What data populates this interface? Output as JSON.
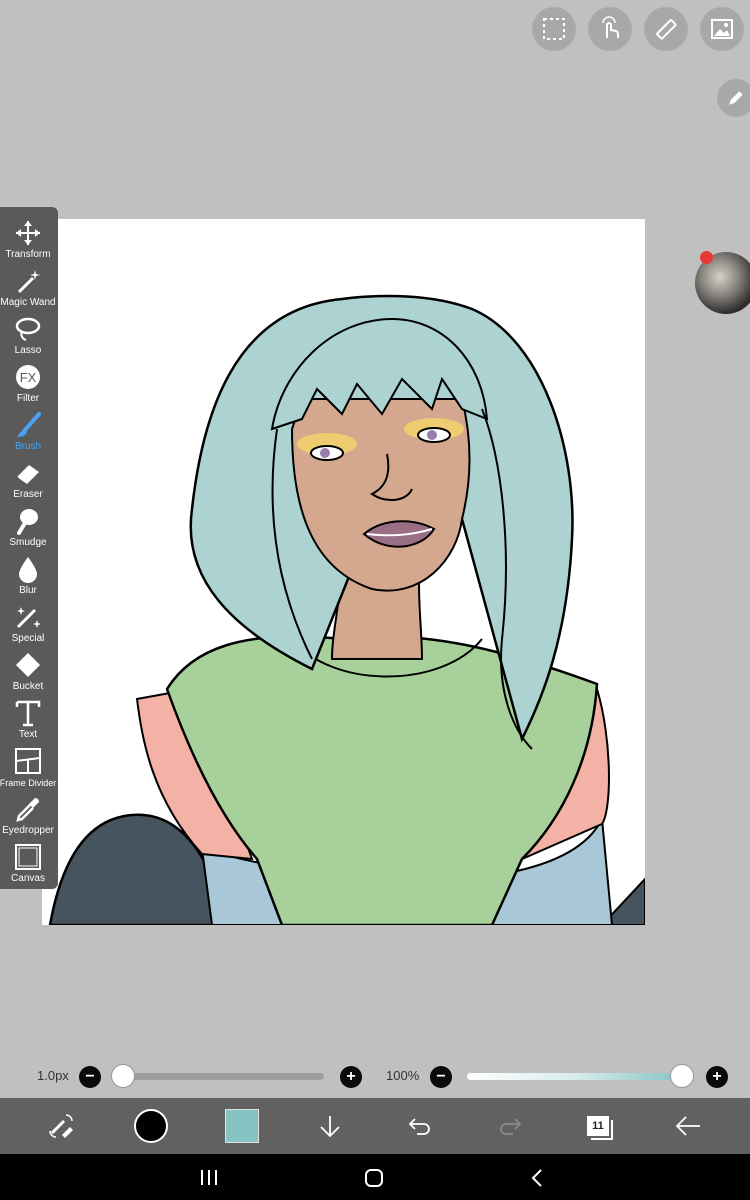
{
  "top_buttons": [
    {
      "name": "selection-icon"
    },
    {
      "name": "hand-touch-icon"
    },
    {
      "name": "ruler-icon"
    },
    {
      "name": "image-icon"
    }
  ],
  "side": {
    "pen_icon": "pencil-icon",
    "avatar": "user-avatar"
  },
  "toolbar": {
    "items": [
      {
        "label": "Transform",
        "icon": "move-arrows-icon"
      },
      {
        "label": "Magic Wand",
        "icon": "magic-wand-icon"
      },
      {
        "label": "Lasso",
        "icon": "lasso-icon"
      },
      {
        "label": "Filter",
        "icon": "fx-icon"
      },
      {
        "label": "Brush",
        "icon": "brush-icon",
        "active": true
      },
      {
        "label": "Eraser",
        "icon": "eraser-icon"
      },
      {
        "label": "Smudge",
        "icon": "smudge-icon"
      },
      {
        "label": "Blur",
        "icon": "droplet-icon"
      },
      {
        "label": "Special",
        "icon": "special-wand-icon"
      },
      {
        "label": "Bucket",
        "icon": "bucket-icon"
      },
      {
        "label": "Text",
        "icon": "text-icon"
      },
      {
        "label": "Frame Divider",
        "icon": "frame-divider-icon"
      },
      {
        "label": "Eyedropper",
        "icon": "eyedropper-icon"
      },
      {
        "label": "Canvas",
        "icon": "canvas-icon"
      }
    ],
    "accent": "#4aa3f0"
  },
  "sliders": {
    "brush_size_label": "1.0px",
    "brush_size_value": 0.0,
    "opacity_label": "100%",
    "opacity_value": 1.0,
    "minus": "−",
    "plus": "+"
  },
  "bottom_bar": {
    "primary_color": "#000000",
    "secondary_color": "#85c3c3",
    "layer_count": "11"
  },
  "artwork": {
    "hair_color": "#acd3d1",
    "skin_color": "#d3a88e",
    "hoodie_green": "#a8d09a",
    "hoodie_pink": "#f4b1a5",
    "hoodie_blue": "#a8c8d8",
    "dark_arm": "#45545e"
  }
}
